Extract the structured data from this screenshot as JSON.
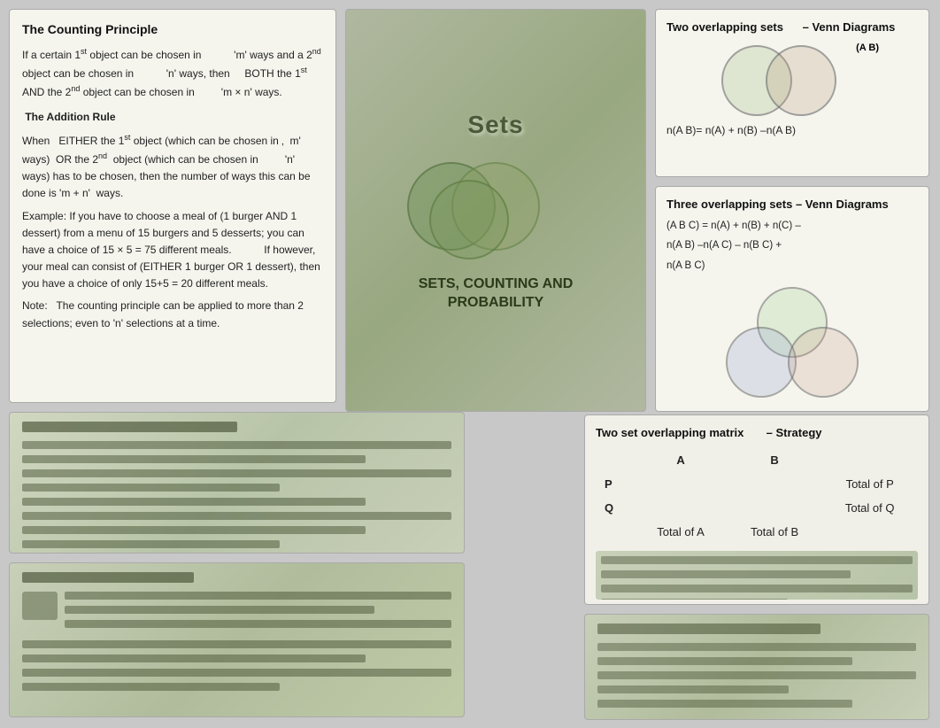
{
  "counting_panel": {
    "title": "The Counting Principle",
    "paragraph1": "If a certain 1",
    "p1_sup1": "st",
    "p1_mid": "object can be chosen in",
    "p1_end": "'m'",
    "paragraph1b": "ways and a 2",
    "p1b_sup": "nd",
    "p1b_mid": "object can be chosen in",
    "p1b_end": "'n'",
    "paragraph1c": "ways, then    BOTH the 1",
    "p1c_sup": "st",
    "p1c_mid": "AND the 2",
    "p1c_sup2": "nd",
    "p1c_end": "object",
    "paragraph1d": "can be chosen in        'm × n'  ways.",
    "addition_title": "The Addition Rule",
    "addition_p1": "When   EITHER the 1",
    "add_sup1": "st",
    "addition_p1b": "object (which can be",
    "addition_p2": "chosen in ‚   m'  ways)  OR the 2",
    "add_sup2": "nd",
    "addition_p2b": "object (which",
    "addition_p3": "can be chosen in        'n' ways) has to be chosen,",
    "addition_p4": "then the number of ways this can be done is",
    "addition_p5": "'m + n'  ways.",
    "example": "Example: If you have to choose a meal of (1 burger AND 1 dessert) from a menu of 15 burgers and 5 desserts; you can have a choice of 15 × 5 = 75 different meals.          If however, your meal can consist of (EITHER 1 burger OR 1 dessert), then you have a choice of only 15+5 = 20 different meals.",
    "note": "Note:   The counting principle can be applied to more than 2 selections; even to 'n' selections at a time."
  },
  "center_panel": {
    "title_line1": "SETS, COUNTING AND",
    "title_line2": "PROBABILITY"
  },
  "venn_two": {
    "title": "Two overlapping sets",
    "subtitle": "– Venn Diagrams",
    "label_ab": "(A    B)",
    "formula": "n(A    B)= n(A) + n(B)   –n(A    B)"
  },
  "venn_three": {
    "title": "Three overlapping sets",
    "subtitle": " – Venn Diagrams",
    "formula_line1": "(A    B    C) = n(A) + n(B) + n(C)     –",
    "formula_line2": "n(A    B) –n(A    C) – n(B    C) +",
    "formula_line3": "n(A    B    C)"
  },
  "matrix_panel": {
    "title": "Two set overlapping matrix",
    "subtitle": "– Strategy",
    "col_a": "A",
    "col_b": "B",
    "row_p": "P",
    "row_q": "Q",
    "total_p": "Total of P",
    "total_q": "Total of Q",
    "total_a": "Total of A",
    "total_b": "Total of B"
  }
}
